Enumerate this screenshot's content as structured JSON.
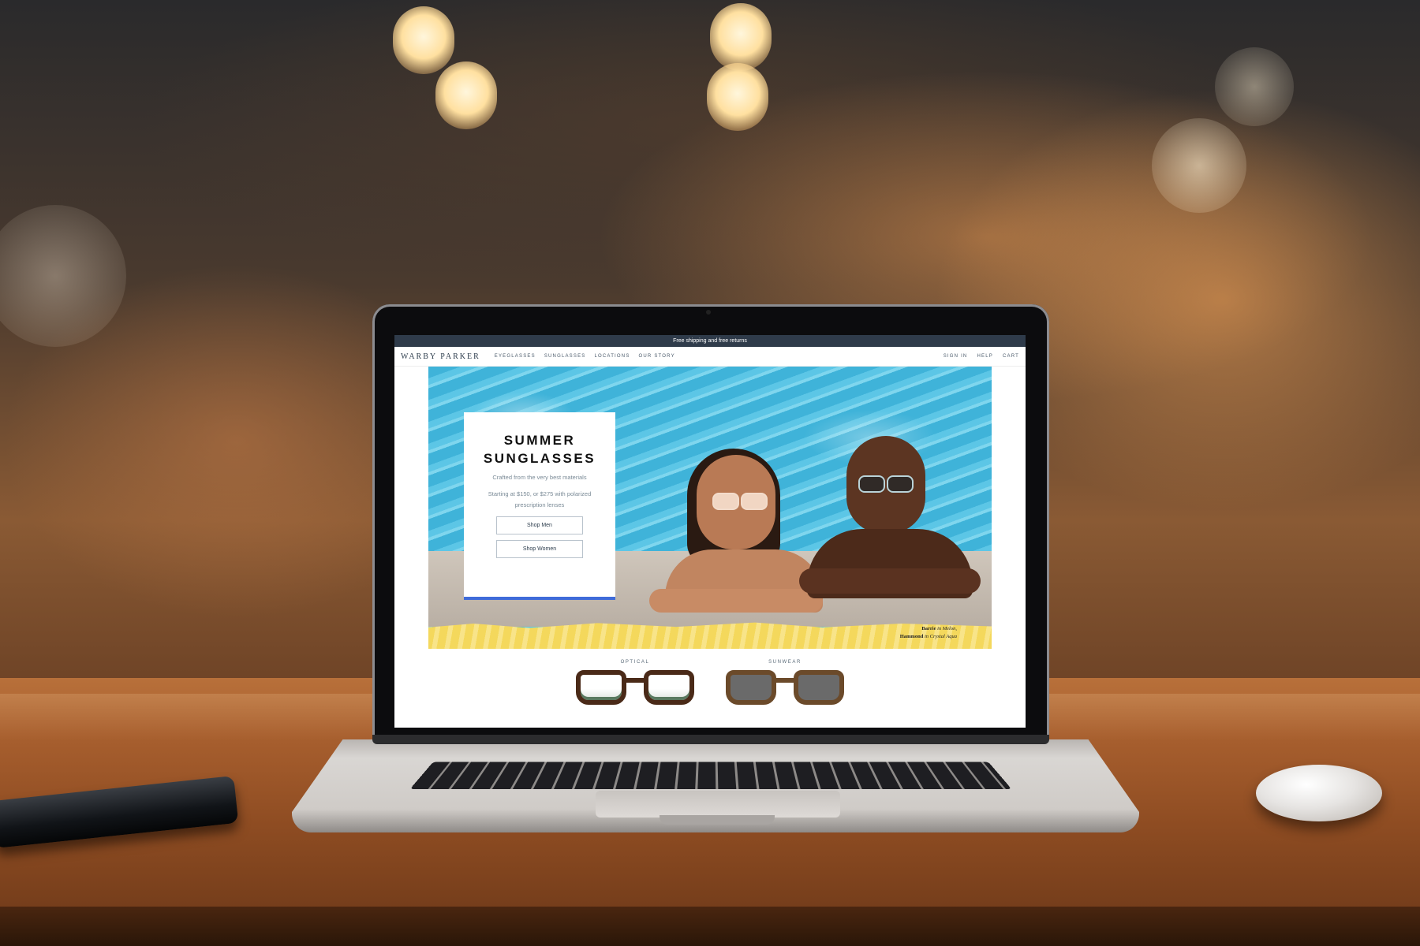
{
  "site": {
    "promo_bar": "Free shipping and free returns",
    "logo": "WARBY PARKER",
    "nav": [
      "EYEGLASSES",
      "SUNGLASSES",
      "LOCATIONS",
      "OUR STORY"
    ],
    "nav_right": [
      "SIGN IN",
      "HELP",
      "CART"
    ]
  },
  "hero": {
    "title": "SUMMER\nSUNGLASSES",
    "subtitle": "Crafted from the very best materials",
    "price_text": "Starting at $150, or $275 with polarized prescription lenses",
    "buttons": [
      "Shop Men",
      "Shop Women"
    ],
    "caption": {
      "line1_bold": "Barrie",
      "line1_italic": " in Melon,",
      "line2_bold": "Hammond",
      "line2_italic": " in Crystal Aqua"
    },
    "accent_color": "#3f6bd9"
  },
  "categories": [
    {
      "label": "OPTICAL"
    },
    {
      "label": "SUNWEAR"
    }
  ],
  "colors": {
    "promo_bar_bg": "#2f3b4a",
    "pool": "#48bde0",
    "towel": "#f4d85c"
  }
}
